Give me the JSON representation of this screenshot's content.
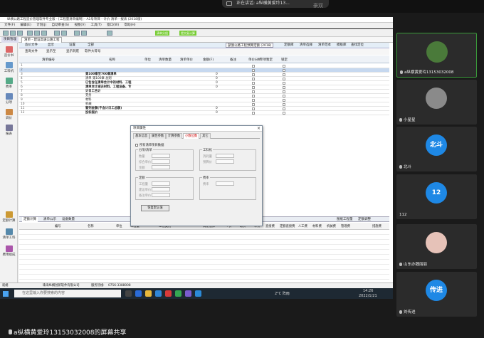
{
  "meeting": {
    "share_status": "正在讲话: a纵横黄爱玲13...",
    "top_name": "豪双",
    "share_banner": "a纵横黄爱玲13153032008的屏幕共享"
  },
  "app": {
    "window_title": "纵横公路工程造价管理软件专业版 - [工程量清单编制] - A1号项目 - 计价 清单 - 报表 (2018版)",
    "menu": [
      "文件(F)",
      "编辑(E)",
      "计划(J)",
      "自动审查(S)",
      "视图(V)",
      "工具(T)",
      "窗口(W)",
      "帮助(H)"
    ],
    "toolbar_buttons": [
      "清单分组",
      "提交复计算"
    ],
    "tabs": [
      "项目管理",
      "清单 - 建设高速公路工程"
    ],
    "subtabs": [
      "造价文件",
      "显示",
      "设置",
      "全部"
    ],
    "sub_toolbar": [
      "查询文件",
      "显示至",
      "显示到底",
      "软件大等号"
    ],
    "standard_select": "部颁公路工程预算定额 (2018)",
    "right_tools": [
      "定额库",
      "清单选择",
      "清单范本",
      "模板库",
      "查找定位"
    ]
  },
  "left_nav": [
    "造价书",
    "工料机",
    "费率",
    "分项",
    "调价",
    "报表",
    "定额计算",
    "清单工料",
    "费用组成"
  ],
  "grid": {
    "headers": [
      "清单编号",
      "名称",
      "单位",
      "清单数量",
      "清单单价",
      "金额(F)",
      "备注",
      "单价分析",
      "专项暂定",
      "锁定"
    ],
    "rows": [
      {
        "no": "1",
        "name": "",
        "value": ""
      },
      {
        "no": "2",
        "name": "",
        "value": ""
      },
      {
        "no": "3",
        "name": "第100章至700章清单",
        "value": "0"
      },
      {
        "no": "4",
        "name": "清单 第100章 总则",
        "value": "0"
      },
      {
        "no": "5",
        "name": "已包含在清单合计中的材料、工程",
        "value": "0"
      },
      {
        "no": "6",
        "name": "清单合计减去材料、工程设备、专",
        "value": "0"
      },
      {
        "no": "7",
        "name": "计日工合计",
        "value": ""
      },
      {
        "no": "8",
        "name": "劳务",
        "value": ""
      },
      {
        "no": "9",
        "name": "材料",
        "value": ""
      },
      {
        "no": "10",
        "name": "机械",
        "value": ""
      },
      {
        "no": "11",
        "name": "暂列金额(不含计日工总额)",
        "value": "0"
      },
      {
        "no": "12",
        "name": "投标报价",
        "value": "0"
      }
    ]
  },
  "lower": {
    "tabs": [
      "定额计算",
      "清单公示",
      "设备数量"
    ],
    "right_tabs": [
      "图纸工程量",
      "定额调整"
    ],
    "headers": [
      "编号",
      "名称",
      "单位",
      "工程量",
      "工程类别",
      "调差信仰",
      "个价",
      "取价",
      "单价",
      "直接费",
      "定额直接费",
      "人工费",
      "材料费",
      "机械费",
      "管理费",
      "措施费"
    ]
  },
  "status": {
    "left": "就绪",
    "company": "珠海纵横创新软件有限公司",
    "service_label": "服务热线:",
    "service_number": "0756-3388008"
  },
  "taskbar": {
    "search_placeholder": "在这里输入你要搜索的内容",
    "weather": "2°C 阵雨",
    "time": "14:26",
    "date": "2022/1/21"
  },
  "dialog": {
    "title": "项目属性",
    "tabs": [
      "基本信息",
      "属性参数",
      "计算参数",
      "小数位数",
      "其它"
    ],
    "selected_tab": "小数位数",
    "checkbox_label": "所有清单项目数据",
    "group1": {
      "title": "分项/清单",
      "fields": [
        "数量",
        "综合单价",
        "金额"
      ]
    },
    "group2": {
      "title": "工料机",
      "fields": [
        "消耗量",
        "预算价"
      ]
    },
    "group3": {
      "title": "定额",
      "fields": [
        "工程量",
        "建设单价",
        "备注单价"
      ]
    },
    "group4": {
      "title": "费率",
      "fields": [
        "费率"
      ]
    },
    "restore_button": "恢复默认值"
  },
  "participants": [
    {
      "name": "a纵横黄爱玲13153032008",
      "avatar_text": "",
      "color": "#4a7a3a"
    },
    {
      "name": "小星星",
      "avatar_text": "",
      "color": "#8a8a8a"
    },
    {
      "name": "北斗",
      "avatar_text": "北斗",
      "color": "#1e88e5"
    },
    {
      "name": "112",
      "avatar_text": "12",
      "color": "#1e88e5"
    },
    {
      "name": "山东办魏丽丽",
      "avatar_text": "",
      "color": "#e6c2b8"
    },
    {
      "name": "刘传进",
      "avatar_text": "传进",
      "color": "#1e88e5"
    }
  ]
}
